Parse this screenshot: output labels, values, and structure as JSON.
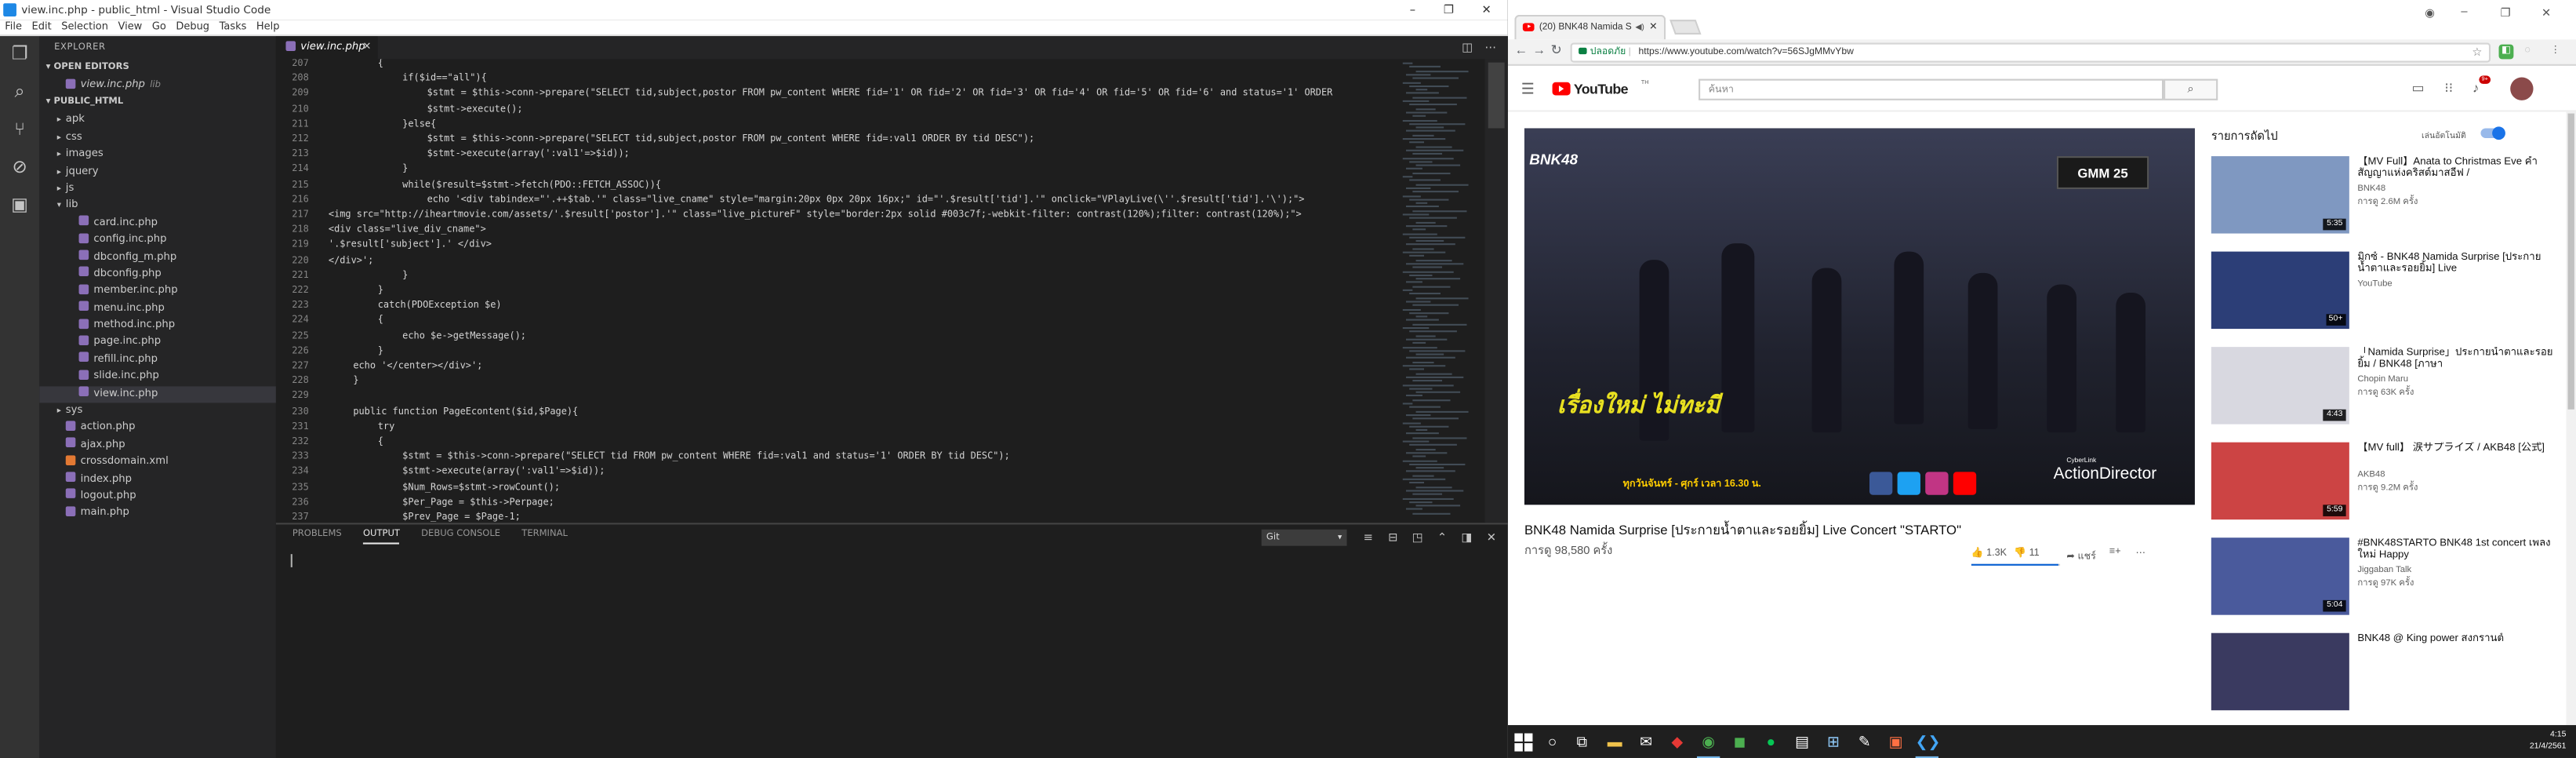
{
  "vscode": {
    "window_title": "view.inc.php - public_html - Visual Studio Code",
    "menu": [
      "File",
      "Edit",
      "Selection",
      "View",
      "Go",
      "Debug",
      "Tasks",
      "Help"
    ],
    "explorer": {
      "header": "EXPLORER",
      "open_editors_label": "OPEN EDITORS",
      "open_editor_file": "view.inc.php",
      "open_editor_path": "lib",
      "project_label": "PUBLIC_HTML",
      "tree": [
        {
          "name": "apk",
          "type": "folder",
          "depth": 1
        },
        {
          "name": "css",
          "type": "folder",
          "depth": 1
        },
        {
          "name": "images",
          "type": "folder",
          "depth": 1
        },
        {
          "name": "jquery",
          "type": "folder",
          "depth": 1
        },
        {
          "name": "js",
          "type": "folder",
          "depth": 1
        },
        {
          "name": "lib",
          "type": "folder-open",
          "depth": 1
        },
        {
          "name": "card.inc.php",
          "type": "php",
          "depth": 2
        },
        {
          "name": "config.inc.php",
          "type": "php",
          "depth": 2
        },
        {
          "name": "dbconfig_m.php",
          "type": "php",
          "depth": 2
        },
        {
          "name": "dbconfig.php",
          "type": "php",
          "depth": 2
        },
        {
          "name": "member.inc.php",
          "type": "php",
          "depth": 2
        },
        {
          "name": "menu.inc.php",
          "type": "php",
          "depth": 2
        },
        {
          "name": "method.inc.php",
          "type": "php",
          "depth": 2
        },
        {
          "name": "page.inc.php",
          "type": "php",
          "depth": 2
        },
        {
          "name": "refill.inc.php",
          "type": "php",
          "depth": 2
        },
        {
          "name": "slide.inc.php",
          "type": "php",
          "depth": 2
        },
        {
          "name": "view.inc.php",
          "type": "php",
          "depth": 2,
          "selected": true
        },
        {
          "name": "sys",
          "type": "folder",
          "depth": 1
        },
        {
          "name": "action.php",
          "type": "php",
          "depth": 1
        },
        {
          "name": "ajax.php",
          "type": "php",
          "depth": 1
        },
        {
          "name": "crossdomain.xml",
          "type": "xml",
          "depth": 1
        },
        {
          "name": "index.php",
          "type": "php",
          "depth": 1
        },
        {
          "name": "logout.php",
          "type": "php",
          "depth": 1
        },
        {
          "name": "main.php",
          "type": "php",
          "depth": 1
        }
      ]
    },
    "active_tab": "view.inc.php",
    "code_lines": [
      {
        "n": "207",
        "indent": 2,
        "text": "{"
      },
      {
        "n": "208",
        "indent": 3,
        "text": "if($id==\"all\"){"
      },
      {
        "n": "209",
        "indent": 4,
        "text": "$stmt = $this->conn->prepare(\"SELECT tid,subject,postor FROM pw_content WHERE fid='1' OR fid='2' OR fid='3' OR fid='4' OR fid='5' OR fid='6' and status='1' ORDER"
      },
      {
        "n": "210",
        "indent": 4,
        "text": "$stmt->execute();"
      },
      {
        "n": "211",
        "indent": 3,
        "text": "}else{"
      },
      {
        "n": "212",
        "indent": 4,
        "text": "$stmt = $this->conn->prepare(\"SELECT tid,subject,postor FROM pw_content WHERE fid=:val1 ORDER BY tid DESC\");"
      },
      {
        "n": "213",
        "indent": 4,
        "text": "$stmt->execute(array(':val1'=>$id));"
      },
      {
        "n": "214",
        "indent": 3,
        "text": "}"
      },
      {
        "n": "215",
        "indent": 3,
        "text": "while($result=$stmt->fetch(PDO::FETCH_ASSOC)){"
      },
      {
        "n": "216",
        "indent": 4,
        "text": "echo '<div tabindex=\"'.++$tab.'\" class=\"live_cname\" style=\"margin:20px 0px 20px 16px;\" id=\"'.$result['tid'].'\" onclick=\"VPlayLive(\\''.$result['tid'].'\\');\">"
      },
      {
        "n": "217",
        "indent": 0,
        "text": "<img src=\"http://iheartmovie.com/assets/'.$result['postor'].'\" class=\"live_pictureF\" style=\"border:2px solid #003c7f;-webkit-filter: contrast(120%);filter: contrast(120%);\">"
      },
      {
        "n": "218",
        "indent": 0,
        "text": "<div class=\"live_div_cname\">"
      },
      {
        "n": "219",
        "indent": 0,
        "text": "'.$result['subject'].' </div>"
      },
      {
        "n": "220",
        "indent": 0,
        "text": "</div>';"
      },
      {
        "n": "221",
        "indent": 3,
        "text": "}"
      },
      {
        "n": "222",
        "indent": 2,
        "text": "}"
      },
      {
        "n": "223",
        "indent": 2,
        "text": "catch(PDOException $e)"
      },
      {
        "n": "224",
        "indent": 2,
        "text": "{"
      },
      {
        "n": "225",
        "indent": 3,
        "text": "echo $e->getMessage();"
      },
      {
        "n": "226",
        "indent": 2,
        "text": "}"
      },
      {
        "n": "227",
        "indent": 1,
        "text": "echo '</center></div>';"
      },
      {
        "n": "228",
        "indent": 1,
        "text": "}"
      },
      {
        "n": "229",
        "indent": 0,
        "text": ""
      },
      {
        "n": "230",
        "indent": 1,
        "text": "public function PageEcontent($id,$Page){"
      },
      {
        "n": "231",
        "indent": 2,
        "text": "try"
      },
      {
        "n": "232",
        "indent": 2,
        "text": "{"
      },
      {
        "n": "233",
        "indent": 3,
        "text": "$stmt = $this->conn->prepare(\"SELECT tid FROM pw_content WHERE fid=:val1 and status='1' ORDER BY tid DESC\");"
      },
      {
        "n": "234",
        "indent": 3,
        "text": "$stmt->execute(array(':val1'=>$id));"
      },
      {
        "n": "235",
        "indent": 3,
        "text": "$Num_Rows=$stmt->rowCount();"
      },
      {
        "n": "236",
        "indent": 3,
        "text": "$Per_Page = $this->Perpage;"
      },
      {
        "n": "237",
        "indent": 3,
        "text": "$Prev_Page = $Page-1;"
      }
    ],
    "panel": {
      "tabs": [
        "PROBLEMS",
        "OUTPUT",
        "DEBUG CONSOLE",
        "TERMINAL"
      ],
      "active_tab": "OUTPUT",
      "output_channel": "Git"
    }
  },
  "chrome": {
    "tab_title": "(20) BNK48 Namida S",
    "address_security": "ปลอดภัย",
    "url": "https://www.youtube.com/watch?v=56SJgMMvYbw"
  },
  "youtube": {
    "logo_text": "YouTube",
    "logo_region": "TH",
    "search_placeholder": "ค้นหา",
    "notification_count": "9+",
    "video_title": "BNK48 Namida Surprise [ประกายน้ำตาและรอยยิ้ม] Live Concert \"STARTO\"",
    "views": "การดู 98,580 ครั้ง",
    "likes": "1.3K",
    "dislikes": "11",
    "share_label": "แชร์",
    "like_ratio": 0.99,
    "player_overlays": {
      "channel_bug": "BNK48",
      "network": "GMM 25",
      "show_title": "เรื่องใหม่ ไม่ทะมี",
      "schedule": "ทุกวันจันทร์ - ศุกร์ เวลา 16.30 น.",
      "watermark_small": "CyberLink",
      "watermark": "ActionDirector"
    },
    "up_next_label": "รายการถัดไป",
    "autoplay_label": "เล่นอัตโนมัติ",
    "autoplay_on": true,
    "recommendations": [
      {
        "title": "【MV Full】Anata to Christmas Eve ค่ำสัญญาแห่งคริสต์มาสอีฟ /",
        "channel": "BNK48",
        "views": "การดู 2.6M ครั้ง",
        "duration": "5:35"
      },
      {
        "title": "มิกซ์ - BNK48 Namida Surprise [ประกายน้ำตาและรอยยิ้ม] Live",
        "channel": "YouTube",
        "views": "",
        "duration": "50+"
      },
      {
        "title": "「Namida Surprise」ประกายน้ำตาและรอยยิ้ม / BNK48 [ภาษา",
        "channel": "Chopin Maru",
        "views": "การดู 63K ครั้ง",
        "duration": "4:43"
      },
      {
        "title": "【MV full】 涙サプライズ / AKB48 [公式]",
        "channel": "AKB48",
        "views": "การดู 9.2M ครั้ง",
        "duration": "5:59"
      },
      {
        "title": "#BNK48STARTO BNK48 1st concert เพลงใหม่ Happy",
        "channel": "Jiggaban Talk",
        "views": "การดู 97K ครั้ง",
        "duration": "5:04"
      },
      {
        "title": "BNK48 @ King power สงกรานต์",
        "channel": "",
        "views": "",
        "duration": ""
      }
    ]
  },
  "taskbar": {
    "time": "4:15",
    "date": "21/4/2561"
  }
}
